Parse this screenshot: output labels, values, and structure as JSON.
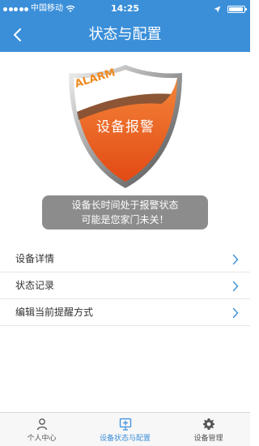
{
  "status_bar": {
    "carrier": "中国移动",
    "time": "14:25"
  },
  "nav": {
    "title": "状态与配置"
  },
  "alarm": {
    "badge_text": "ALARM",
    "shield_label": "设备报警",
    "message_line1": "设备长时间处于报警状态",
    "message_line2": "可能是您家门未关！"
  },
  "menu": {
    "items": [
      {
        "label": "设备详情"
      },
      {
        "label": "状态记录"
      },
      {
        "label": "编辑当前提醒方式"
      }
    ]
  },
  "tabs": [
    {
      "label": "个人中心",
      "icon": "person-icon"
    },
    {
      "label": "设备状态与配置",
      "icon": "device-status-icon"
    },
    {
      "label": "设备管理",
      "icon": "gear-icon"
    }
  ],
  "colors": {
    "primary": "#3b8fd9",
    "shield_orange": "#ea5f1f",
    "alert_box": "#8c8c8c"
  }
}
